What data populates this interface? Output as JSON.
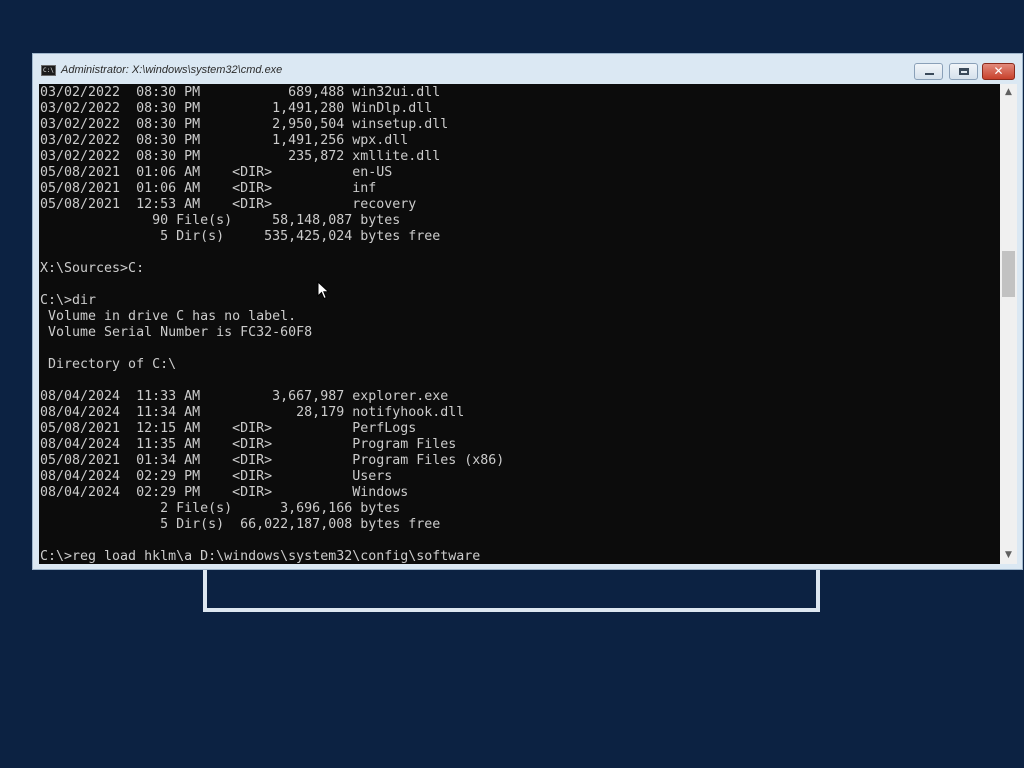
{
  "window": {
    "title": "Administrator: X:\\windows\\system32\\cmd.exe",
    "icon": "cmd-icon",
    "icon_text": "C:\\",
    "buttons": {
      "minimize": "minimize-icon",
      "maximize": "maximize-icon",
      "close": "close-icon",
      "close_glyph": "✕"
    }
  },
  "console": {
    "lines": [
      "03/02/2022  08:30 PM           689,488 win32ui.dll",
      "03/02/2022  08:30 PM         1,491,280 WinDlp.dll",
      "03/02/2022  08:30 PM         2,950,504 winsetup.dll",
      "03/02/2022  08:30 PM         1,491,256 wpx.dll",
      "03/02/2022  08:30 PM           235,872 xmllite.dll",
      "05/08/2021  01:06 AM    <DIR>          en-US",
      "05/08/2021  01:06 AM    <DIR>          inf",
      "05/08/2021  12:53 AM    <DIR>          recovery",
      "              90 File(s)     58,148,087 bytes",
      "               5 Dir(s)     535,425,024 bytes free",
      "",
      "X:\\Sources>C:",
      "",
      "C:\\>dir",
      " Volume in drive C has no label.",
      " Volume Serial Number is FC32-60F8",
      "",
      " Directory of C:\\",
      "",
      "08/04/2024  11:33 AM         3,667,987 explorer.exe",
      "08/04/2024  11:34 AM            28,179 notifyhook.dll",
      "05/08/2021  12:15 AM    <DIR>          PerfLogs",
      "08/04/2024  11:35 AM    <DIR>          Program Files",
      "05/08/2021  01:34 AM    <DIR>          Program Files (x86)",
      "08/04/2024  02:29 PM    <DIR>          Users",
      "08/04/2024  02:29 PM    <DIR>          Windows",
      "               2 File(s)      3,696,166 bytes",
      "               5 Dir(s)  66,022,187,008 bytes free",
      "",
      "C:\\>reg load hklm\\a D:\\windows\\system32\\config\\software"
    ]
  },
  "scrollbar": {
    "up_arrow": "▲",
    "down_arrow": "▼"
  },
  "pointer": "mouse-pointer-icon"
}
